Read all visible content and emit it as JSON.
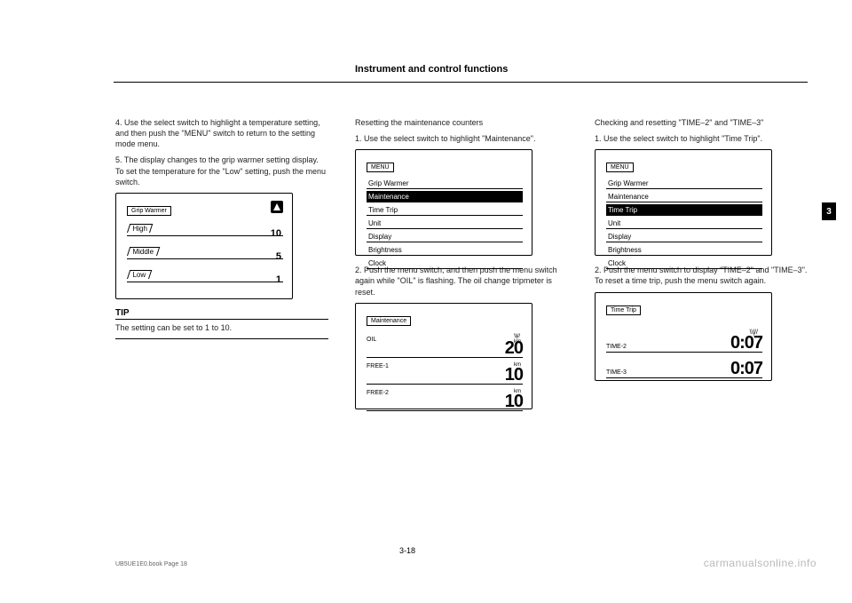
{
  "header": {
    "title": "Instrument and control functions"
  },
  "section_tab": "3",
  "col1": {
    "p1": "4. Use the select switch to highlight a temperature setting, and then push the \"MENU\" switch to return to the setting mode menu.",
    "p2": "5. The display changes to the grip warmer setting display. To set the temperature for the \"Low\" setting, push the menu switch."
  },
  "grip_panel": {
    "title": "Grip Warmer",
    "rows": [
      {
        "label": "High",
        "value": "10"
      },
      {
        "label": "Middle",
        "value": "5"
      },
      {
        "label": "Low",
        "value": "1"
      }
    ]
  },
  "tip": {
    "label": "TIP",
    "text": "The setting can be set to 1 to 10."
  },
  "col2": {
    "p1": "Resetting the maintenance counters",
    "p2": "1. Use the select switch to highlight \"Maintenance\"."
  },
  "menu1": {
    "title": "MENU",
    "items": [
      "Grip Warmer",
      "Maintenance",
      "Time Trip",
      "Unit",
      "Display",
      "Brightness",
      "Clock"
    ],
    "selected": 1
  },
  "col2b": {
    "p3": "2. Push the menu switch, and then push the menu switch again while \"OIL\" is flashing. The oil change tripmeter is reset."
  },
  "maint_panel": {
    "title": "Maintenance",
    "rows": [
      {
        "label": "OIL",
        "unit": "km",
        "value": "20",
        "ticks": true
      },
      {
        "label": "FREE-1",
        "unit": "km",
        "value": "10"
      },
      {
        "label": "FREE-2",
        "unit": "km",
        "value": "10"
      }
    ]
  },
  "col3": {
    "p1": "Checking and resetting \"TIME–2\" and \"TIME–3\"",
    "p2": "1. Use the select switch to highlight \"Time Trip\"."
  },
  "menu2": {
    "title": "MENU",
    "items": [
      "Grip Warmer",
      "Maintenance",
      "Time Trip",
      "Unit",
      "Display",
      "Brightness",
      "Clock"
    ],
    "selected": 2
  },
  "col3b": {
    "p3": "2. Push the menu switch to display \"TIME–2\" and \"TIME–3\". To reset a time trip, push the menu switch again."
  },
  "timetrip_panel": {
    "title": "Time Trip",
    "rows": [
      {
        "label": "TIME-2",
        "value": "0:07",
        "ticks": true
      },
      {
        "label": "TIME-3",
        "value": "0:07"
      }
    ]
  },
  "watermark": "carmanualsonline.info",
  "page_number": "3-18",
  "footcode": "UB5UE1E0.book  Page 18"
}
